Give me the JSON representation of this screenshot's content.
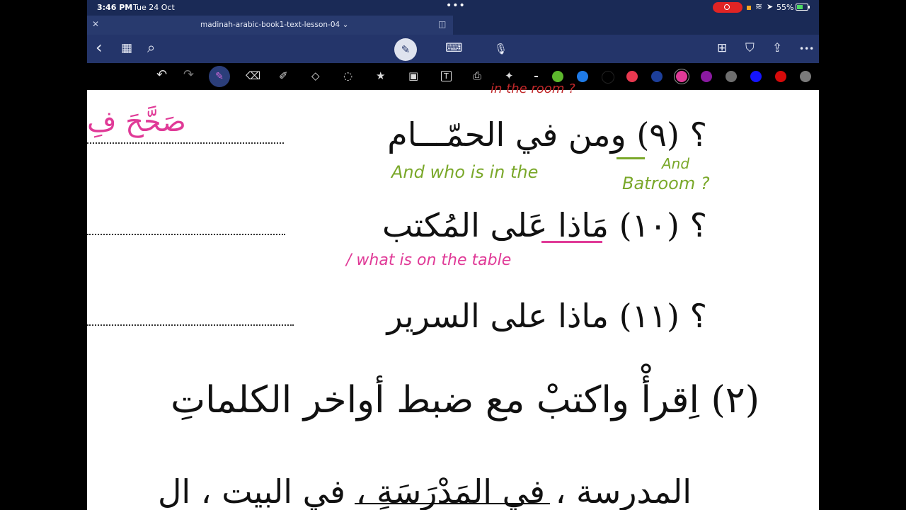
{
  "status_bar": {
    "time": "3:46 PM",
    "date": "Tue 24 Oct",
    "dots": "•••",
    "battery": "55%"
  },
  "tab": {
    "title": "madinah-arabic-book1-text-lesson-04 ⌄",
    "close": "✕",
    "split": "◫"
  },
  "nav": {
    "back": "‹",
    "grid": "▦",
    "search": "⌕",
    "pen": "✎",
    "keyboard": "⌨",
    "mic": "🎙",
    "new_page": "⊞",
    "bookmark": "⛉",
    "share": "⇪",
    "more": "•••"
  },
  "toolbar": {
    "undo": "↶",
    "redo": "↷",
    "pen": "✎",
    "eraser": "⌫",
    "highlighter": "✐",
    "shapes": "◇",
    "lasso": "◌",
    "sticker": "★",
    "image": "▣",
    "text": "T",
    "scan": "⎙",
    "laser": "✦",
    "colors": [
      "#5db82d",
      "#1f7be8",
      "#000000",
      "#e8384f",
      "#1d3f9a",
      "#e03a97",
      "#8a1aa0",
      "#6f6f6f",
      "#1414ff",
      "#d60a0a",
      "#7a7a7a"
    ],
    "selected_color": "#e03a97"
  },
  "document": {
    "q9": "؟ (٩) ومن في الحمّـــام",
    "q10": "؟ (١٠) مَاذا عَلى المُكتب",
    "q11": "؟ (١١) ماذا على السرير",
    "ex2": "(٢) اِقرأْ واكتبْ مع ضبط أواخر الكلماتِ",
    "line_bottom": "المدرسة ، في المَدْرَسَةِ ، في البيت ، ال",
    "pink_partial": "صَحَّحَ فِ",
    "top_cut_note": "in the room ?"
  },
  "annotations": {
    "green_1": "And who is in the",
    "green_2": "And",
    "green_3": "Batroom ?",
    "pink_1": "/ what is on the table"
  }
}
